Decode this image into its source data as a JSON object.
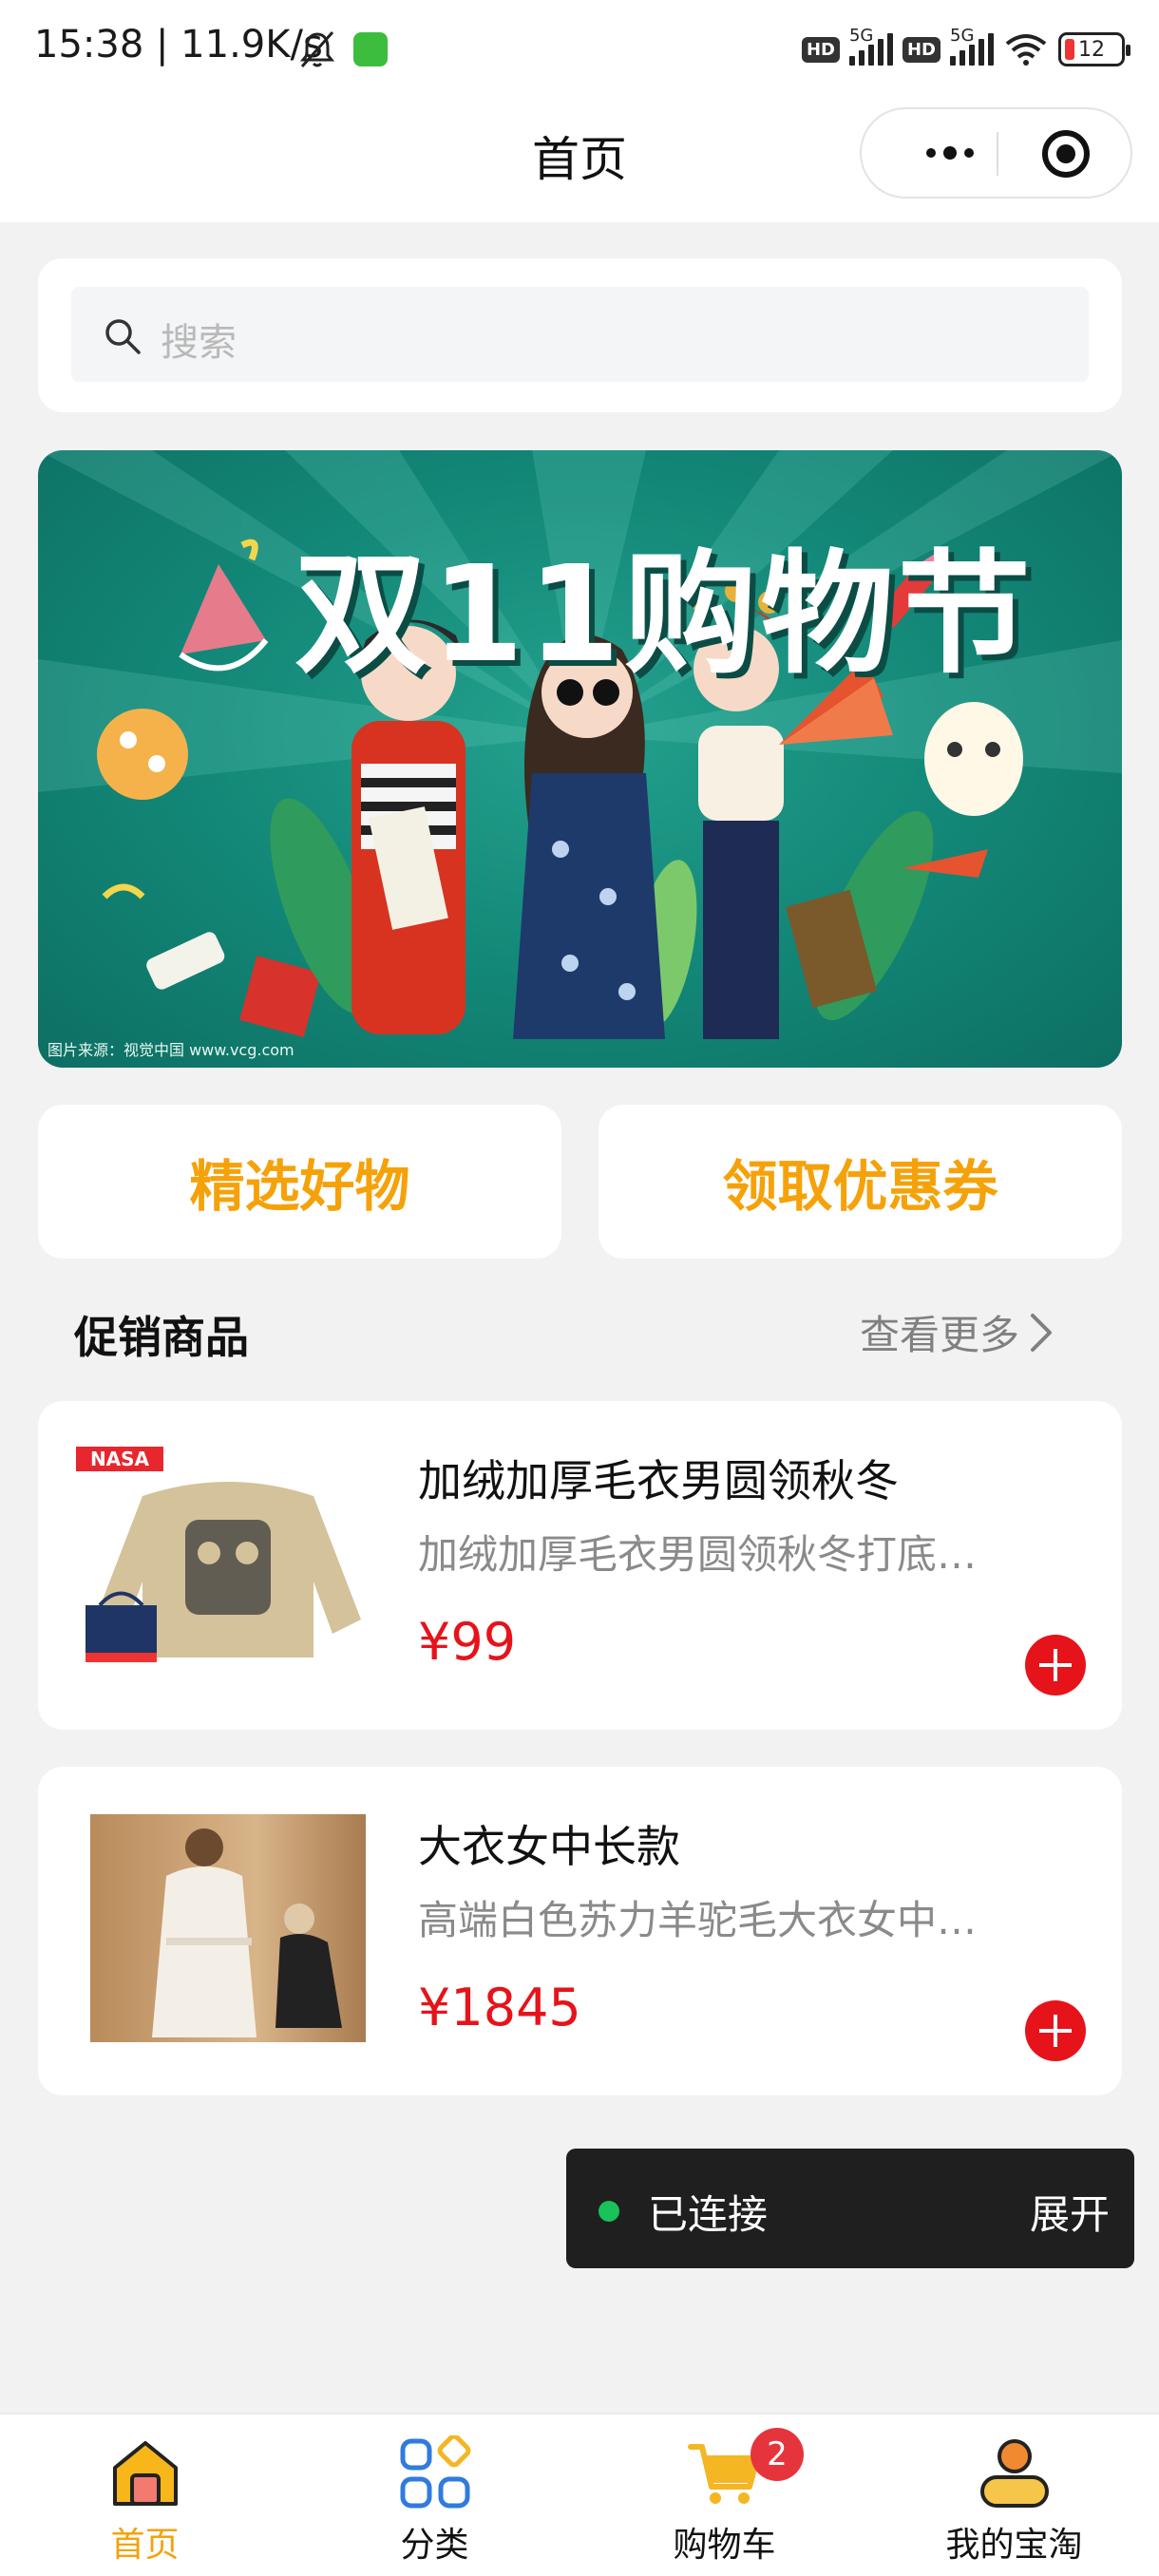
{
  "status_bar": {
    "time_speed": "15:38 | 11.9K/s",
    "hd1": "HD",
    "net1": "5G",
    "hd2": "HD",
    "net2": "5G",
    "battery": "12",
    "icons": [
      "mute-bell-icon",
      "app-notification-icon",
      "signal-icon",
      "wifi-icon",
      "battery-icon"
    ]
  },
  "nav": {
    "title": "首页",
    "capsule_icons": [
      "more-icon",
      "target-icon"
    ]
  },
  "search": {
    "placeholder": "搜索"
  },
  "banner": {
    "title": "双11购物节",
    "credit": "图片来源：视觉中国 www.vcg.com"
  },
  "actions": {
    "featured_label": "精选好物",
    "coupon_label": "领取优惠券",
    "accent": "#f5a20a"
  },
  "promo_section": {
    "title": "促销商品",
    "more_label": "查看更多"
  },
  "products": [
    {
      "name": "加绒加厚毛衣男圆领秋冬",
      "desc": "加绒加厚毛衣男圆领秋冬打底…",
      "price": "¥99",
      "image_text": "NASA"
    },
    {
      "name": "大衣女中长款",
      "desc": "高端白色苏力羊驼毛大衣女中…",
      "price": "¥1845"
    }
  ],
  "toast": {
    "status": "已连接",
    "expand_label": "展开"
  },
  "tabbar": {
    "tabs": [
      {
        "label": "首页",
        "icon": "home-icon",
        "active": true
      },
      {
        "label": "分类",
        "icon": "category-icon"
      },
      {
        "label": "购物车",
        "icon": "cart-icon",
        "badge": "2"
      },
      {
        "label": "我的宝淘",
        "icon": "profile-icon"
      }
    ]
  },
  "colors": {
    "price_red": "#e6131b",
    "banner_teal": "#138878",
    "page_bg": "#f2f2f2"
  }
}
